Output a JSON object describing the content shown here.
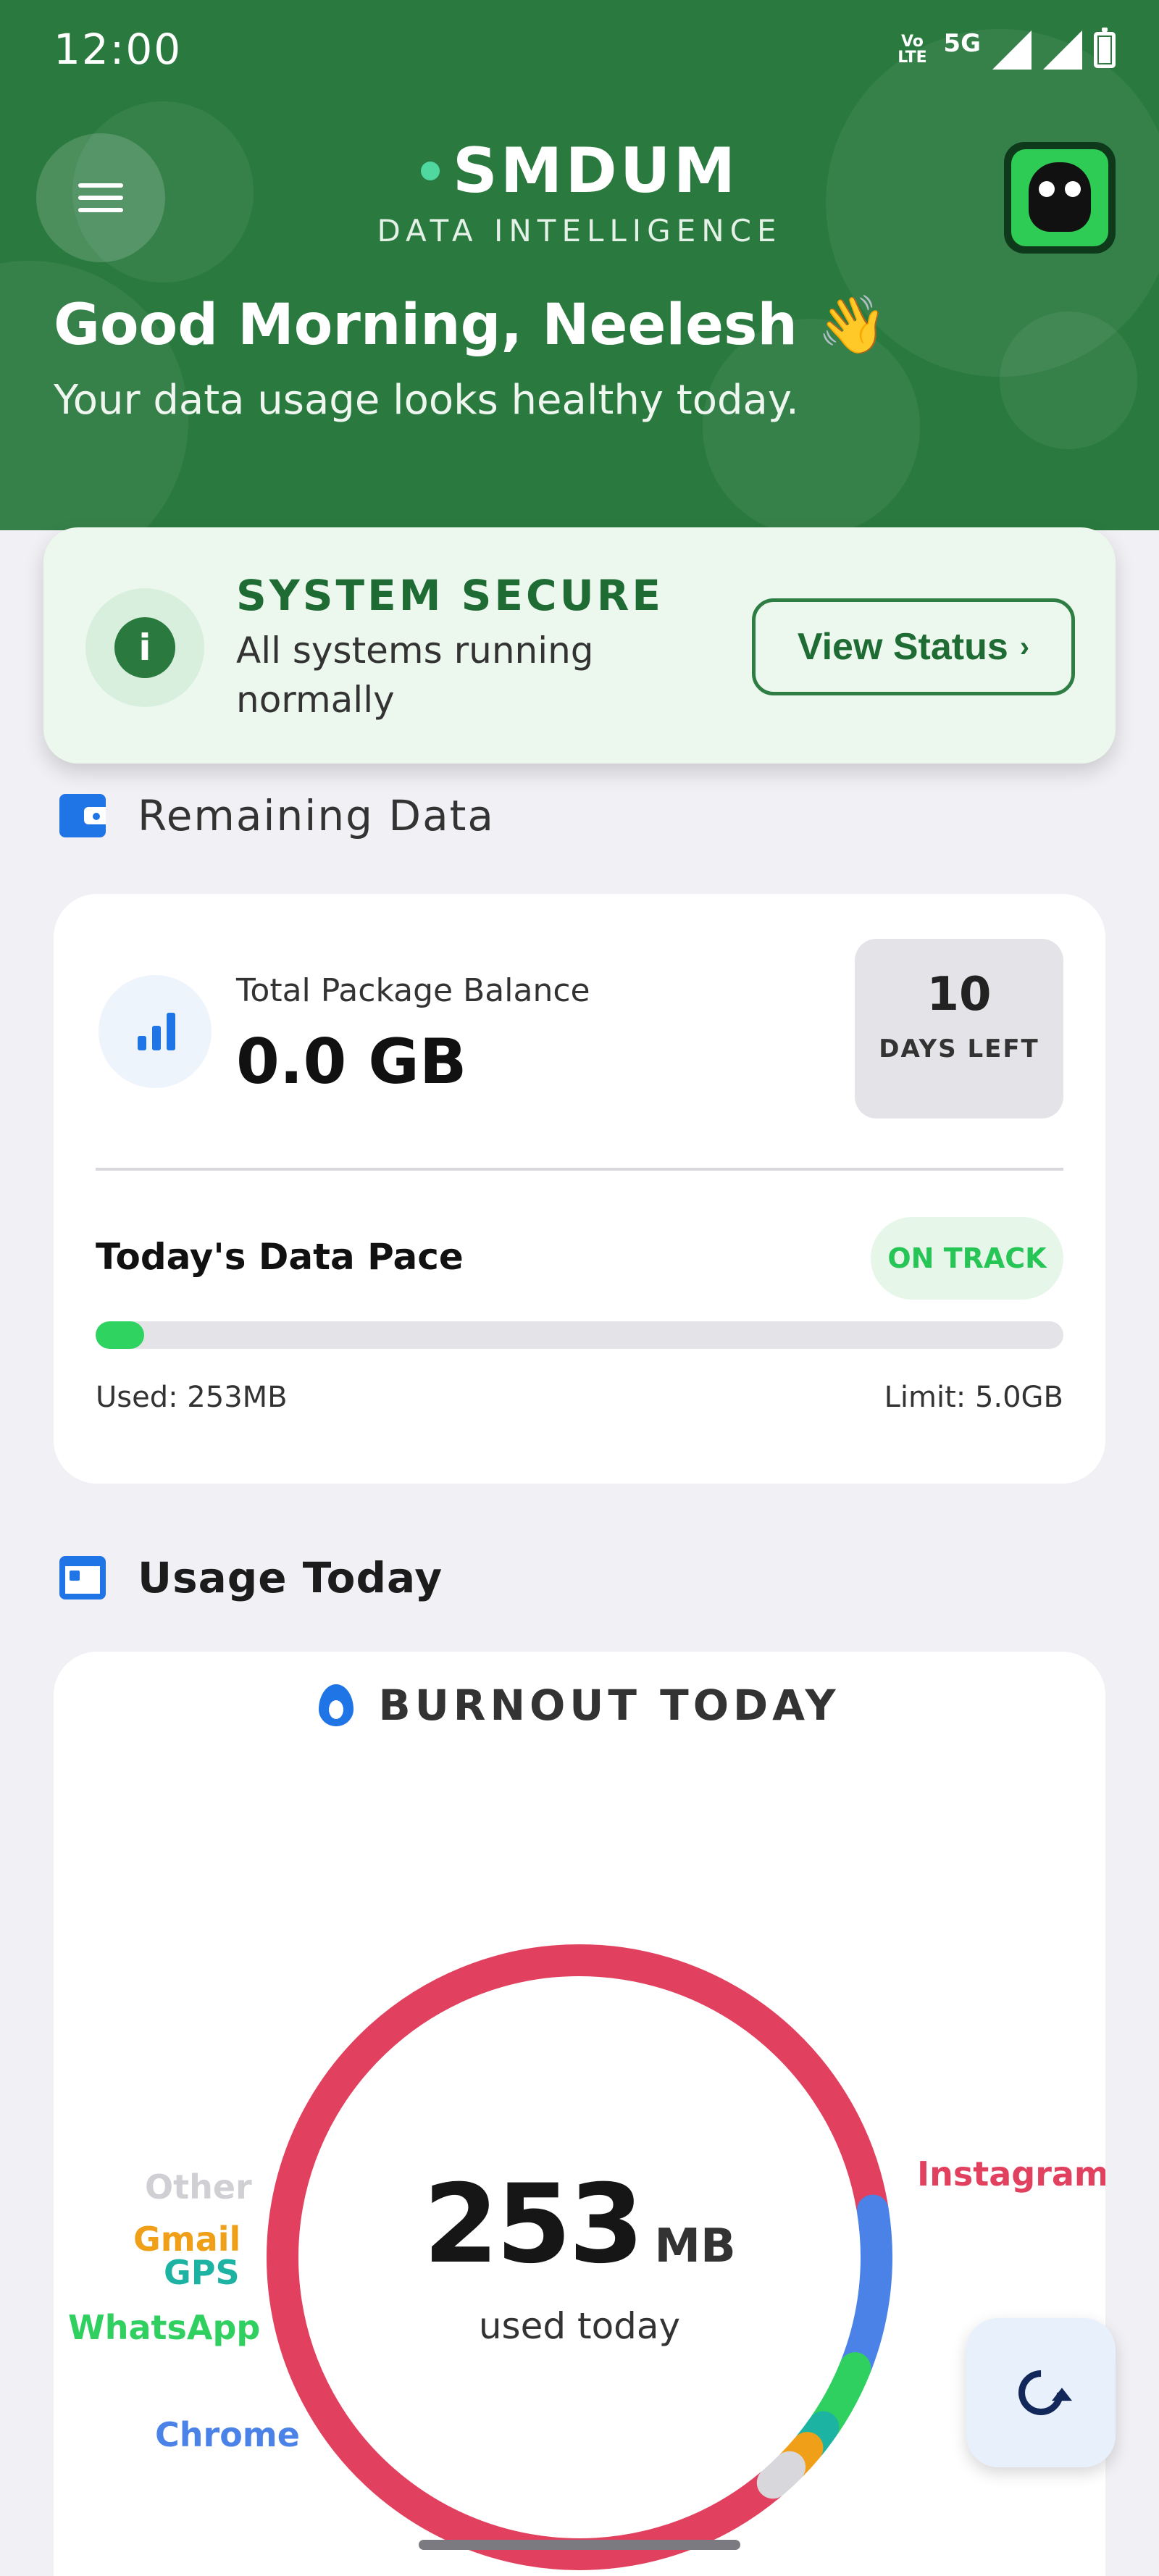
{
  "status_bar": {
    "time": "12:00",
    "volte": "Vo LTE",
    "network": "5G",
    "signal_icon": "signal-icon",
    "battery_icon": "battery-icon"
  },
  "header": {
    "menu_icon": "hamburger-menu-icon",
    "brand_name": "SMDUM",
    "brand_subtitle": "DATA INTELLIGENCE",
    "logo_icon": "owl-logo-icon",
    "greeting": "Good Morning, Neelesh 👋",
    "subtitle": "Your data usage looks healthy today.",
    "bg_color": "#2a7a3f"
  },
  "system_status": {
    "icon": "info-icon",
    "title": "SYSTEM SECURE",
    "description": "All systems running normally",
    "button_label": "View Status",
    "button_chevron": "›"
  },
  "remaining_data": {
    "section_icon": "wallet-icon",
    "section_title": "Remaining Data",
    "balance_icon": "signal-bars-icon",
    "balance_label": "Total Package Balance",
    "balance_value": "0.0 GB",
    "days_left_number": "10",
    "days_left_label": "DAYS LEFT",
    "pace_title": "Today's Data Pace",
    "pace_status": "ON TRACK",
    "pace_progress_fraction": 0.05,
    "used_label": "Used: 253MB",
    "limit_label": "Limit: 5.0GB"
  },
  "usage_today": {
    "section_icon": "calendar-icon",
    "section_title": "Usage Today",
    "card_icon": "flame-icon",
    "card_title": "BURNOUT TODAY",
    "total_value": "253",
    "total_unit": "MB",
    "total_caption": "used today",
    "apps": [
      {
        "name": "Instagram",
        "color": "#e2405f"
      },
      {
        "name": "Chrome",
        "color": "#4a82e8"
      },
      {
        "name": "WhatsApp",
        "color": "#2fd060"
      },
      {
        "name": "GPS",
        "color": "#1db3a3"
      },
      {
        "name": "Gmail",
        "color": "#f0a018"
      },
      {
        "name": "Other",
        "color": "#d8d8dc"
      }
    ],
    "shares_percent": [
      83.6,
      8.6,
      3.6,
      1.4,
      1.4,
      1.4
    ]
  },
  "fab": {
    "icon": "refresh-icon"
  }
}
